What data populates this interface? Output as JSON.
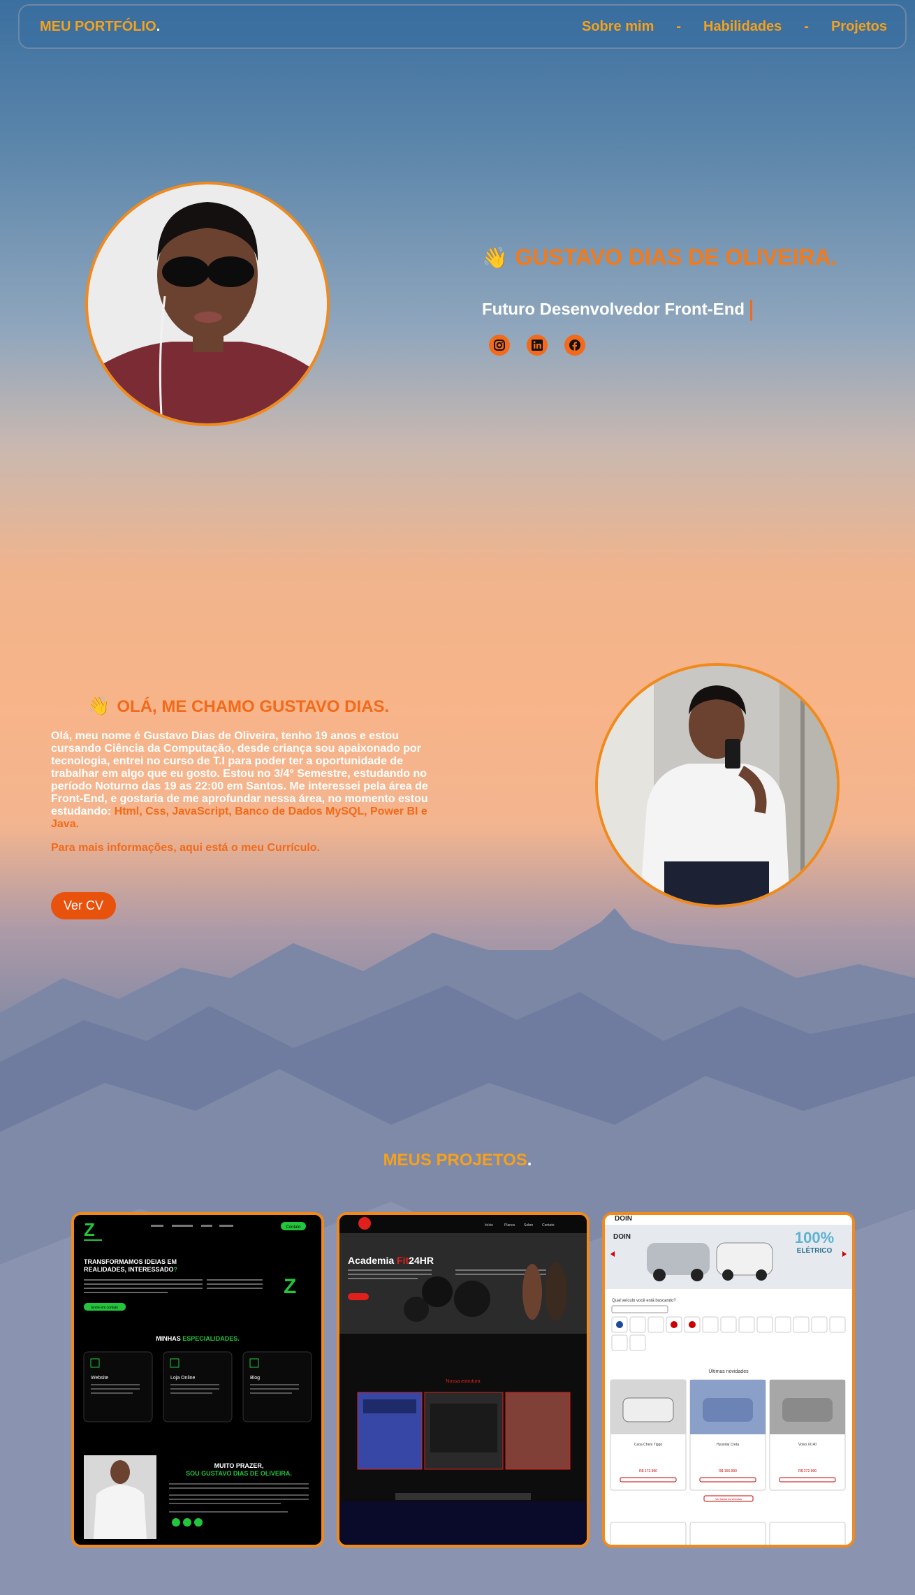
{
  "nav": {
    "brand": "MEU PORTFÓLIO",
    "brand_dot": ".",
    "links": [
      "Sobre mim",
      "Habilidades",
      "Projetos"
    ],
    "separator": "-"
  },
  "hero": {
    "wave": "👋",
    "name": "GUSTAVO DIAS DE OLIVEIRA.",
    "subtitle": "Futuro Desenvolvedor Front-End",
    "socials": [
      "instagram-icon",
      "linkedin-icon",
      "facebook-icon"
    ]
  },
  "about": {
    "wave": "👋",
    "title": "OLÁ, ME CHAMO GUSTAVO DIAS.",
    "text": "Olá, meu nome é Gustavo Dias de Oliveira, tenho 19 anos e estou cursando Ciência da Computação, desde criança sou apaixonado por tecnologia, entrei no curso de T.I para poder ter a oportunidade de trabalhar em algo que eu gosto. Estou no 3/4° Semestre, estudando no período Noturno das 19 as 22:00 em Santos. Me interessei pela área de Front-End, e gostaria de me aprofundar nessa área, no momento estou estudando: ",
    "skills": "Html, Css, JavaScript, Banco de Dados MySQL, Power BI e Java.",
    "more": "Para mais informações, aqui está o meu Currículo.",
    "cv_button": "Ver CV"
  },
  "projects": {
    "title": "MEUS PROJETOS",
    "title_dot": ".",
    "card1": {
      "heading": "TRANSFORMAMOS IDEIAS EM REALIDADES, INTERESSADO?",
      "cta": "Entre em contato",
      "section": "MINHAS ",
      "section_hl": "ESPECIALIDADES.",
      "services": [
        "Website",
        "Loja Online",
        "Blog"
      ],
      "about_title": "MUITO PRAZER,",
      "about_sub": "SOU GUSTAVO DIAS DE OLIVEIRA.",
      "nav_btn": "Contato"
    },
    "card2": {
      "title_a": "Academia ",
      "title_b": "Fit",
      "title_c": "24HR",
      "section": "Nossa estrutura",
      "nav": [
        "Início",
        "Planos",
        "Sobre",
        "Contato"
      ]
    },
    "card3": {
      "brand": "DOIN",
      "banner": "100%",
      "banner2": "ELÉTRICO",
      "question": "Qual veículo você está buscando?",
      "section": "Últimas novidades",
      "cars": [
        {
          "name": "Caoa Chery Tiggo",
          "price": "R$ 172.990"
        },
        {
          "name": "Hyundai Creta",
          "price": "R$ 156.990"
        },
        {
          "name": "Volvo XC40",
          "price": "R$ 272.990"
        }
      ],
      "more": "Ver todos os veículos"
    }
  }
}
